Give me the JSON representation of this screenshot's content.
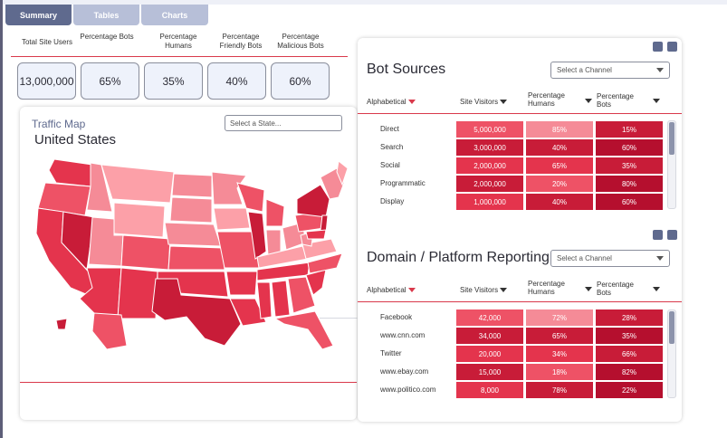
{
  "tabs": [
    {
      "label": "Summary"
    },
    {
      "label": "Tables"
    },
    {
      "label": "Charts"
    }
  ],
  "metrics": {
    "headers": [
      "Total Site Users",
      "Percentage Bots",
      "Percentage Humans",
      "Percentage Friendly Bots",
      "Percentage Malicious Bots"
    ],
    "values": [
      "13,000,000",
      "65%",
      "35%",
      "40%",
      "60%"
    ]
  },
  "traffic_map": {
    "title": "Traffic Map",
    "country": "United States",
    "state_select_placeholder": "Select a State..."
  },
  "bot_sources": {
    "title": "Bot Sources",
    "channel_select_placeholder": "Select a Channel",
    "columns": [
      "Alphabetical",
      "Site Visitors",
      "Percentage Humans",
      "Percentage Bots"
    ],
    "rows": [
      {
        "label": "Direct",
        "visitors": "5,000,000",
        "humans": "85%",
        "bots": "15%"
      },
      {
        "label": "Search",
        "visitors": "3,000,000",
        "humans": "40%",
        "bots": "60%"
      },
      {
        "label": "Social",
        "visitors": "2,000,000",
        "humans": "65%",
        "bots": "35%"
      },
      {
        "label": "Programmatic",
        "visitors": "2,000,000",
        "humans": "20%",
        "bots": "80%"
      },
      {
        "label": "Display",
        "visitors": "1,000,000",
        "humans": "40%",
        "bots": "60%"
      }
    ]
  },
  "domain_reporting": {
    "title": "Domain / Platform Reporting",
    "channel_select_placeholder": "Select a Channel",
    "columns": [
      "Alphabetical",
      "Site Visitors",
      "Percentage Humans",
      "Percentage Bots"
    ],
    "rows": [
      {
        "label": "Facebook",
        "visitors": "42,000",
        "humans": "72%",
        "bots": "28%"
      },
      {
        "label": "www.cnn.com",
        "visitors": "34,000",
        "humans": "65%",
        "bots": "35%"
      },
      {
        "label": "Twitter",
        "visitors": "20,000",
        "humans": "34%",
        "bots": "66%"
      },
      {
        "label": "www.ebay.com",
        "visitors": "15,000",
        "humans": "18%",
        "bots": "82%"
      },
      {
        "label": "www.politico.com",
        "visitors": "8,000",
        "humans": "78%",
        "bots": "22%"
      }
    ]
  },
  "colors": {
    "accent": "#d9394b",
    "tab_active": "#5f6a8e",
    "tab_inactive": "#b7bfd8",
    "red_shades": [
      "#f58b97",
      "#ee5266",
      "#e4344d",
      "#c81c38",
      "#b50f2e"
    ]
  }
}
